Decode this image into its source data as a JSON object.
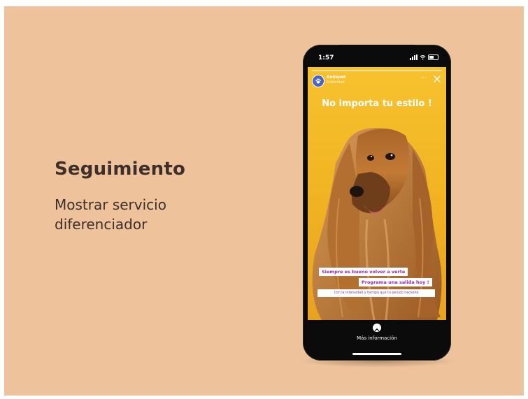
{
  "slide": {
    "heading": "Seguimiento",
    "subtitle": "Mostrar servicio diferenciador"
  },
  "phone": {
    "status_time": "1:57",
    "story": {
      "account_name": "Rolispet",
      "sponsored_label": "Publicidad",
      "headline": "No importa tu estilo !",
      "sticker_1": "Siempre es bueno volver a verte",
      "sticker_2": "Programa una salida hoy !",
      "sticker_3": "Con la intensidad y tiempo que tu peludo necesite",
      "cta_label": "Más información"
    }
  },
  "colors": {
    "background": "#eec39c",
    "heading_text": "#3e2f2b",
    "story_yellow": "#f5bd2a",
    "sticker_text": "#9b27b0"
  },
  "icons": [
    "signal-icon",
    "wifi-icon",
    "battery-icon",
    "paw-icon",
    "more-icon",
    "close-icon",
    "chevron-up-icon"
  ]
}
